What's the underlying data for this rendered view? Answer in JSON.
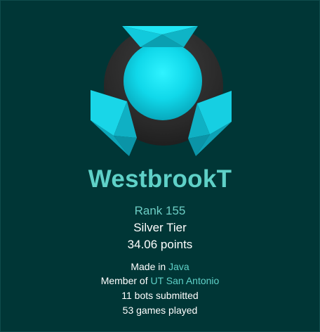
{
  "profile": {
    "username": "WestbrookT",
    "rank": "Rank 155",
    "tier": "Silver Tier",
    "points": "34.06 points",
    "language_prefix": "Made in",
    "language": "Java",
    "org_prefix": "Member of",
    "organization": "UT San Antonio",
    "bots_submitted": "11 bots submitted",
    "games_played": "53 games played"
  },
  "colors": {
    "background": "#003636",
    "accent": "#5fd1c8",
    "text": "#ffffff"
  },
  "icons": {
    "logo": "halite-logo-icon"
  }
}
